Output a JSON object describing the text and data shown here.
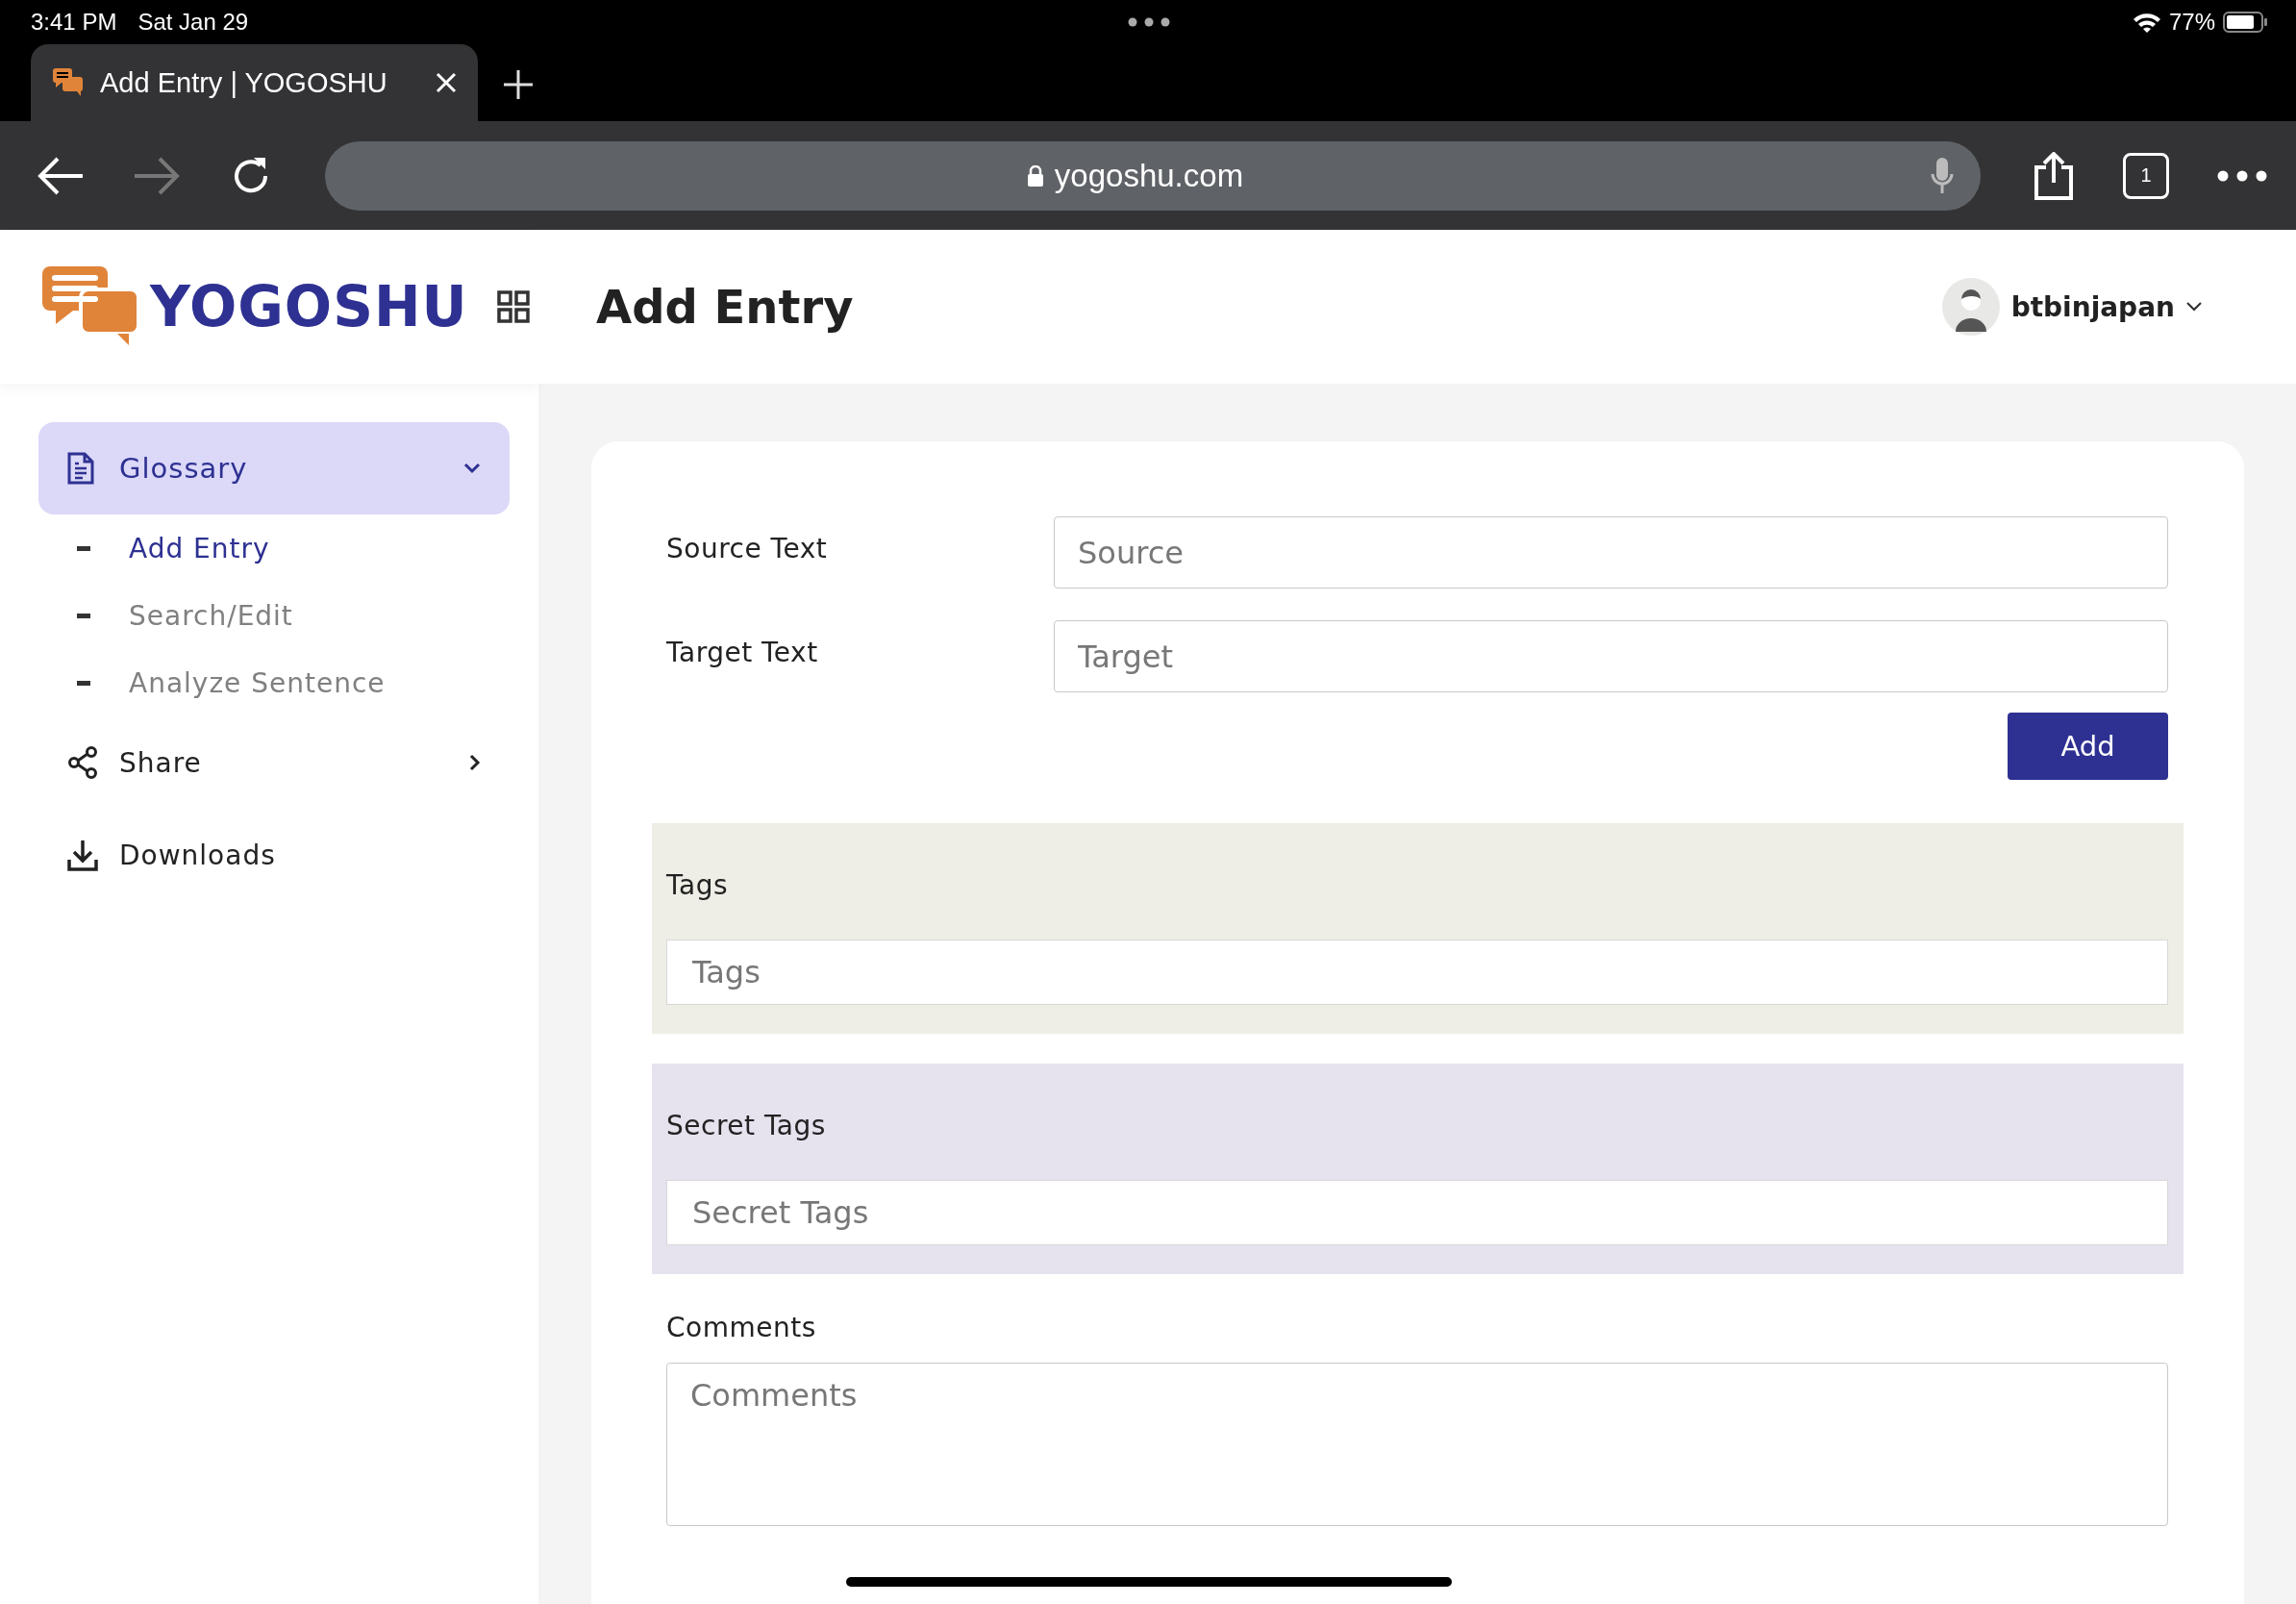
{
  "status_bar": {
    "time": "3:41 PM",
    "date": "Sat Jan 29",
    "battery": "77%"
  },
  "browser": {
    "tab": {
      "title": "Add Entry | YOGOSHU"
    },
    "url": "yogoshu.com",
    "tab_count": "1"
  },
  "sidebar": {
    "logo": "YOGOSHU",
    "items": [
      {
        "kind": "group",
        "label": "Glossary",
        "expanded": true,
        "children": [
          {
            "label": "Add Entry",
            "selected": true
          },
          {
            "label": "Search/Edit",
            "selected": false
          },
          {
            "label": "Analyze Sentence",
            "selected": false
          }
        ]
      },
      {
        "kind": "share",
        "label": "Share",
        "expanded": false
      },
      {
        "kind": "download",
        "label": "Downloads"
      }
    ]
  },
  "header": {
    "title": "Add Entry",
    "user": "btbinjapan"
  },
  "form": {
    "fields": [
      {
        "label": "Source Text",
        "placeholder": "Source"
      },
      {
        "label": "Target Text",
        "placeholder": "Target"
      }
    ],
    "add_button": "Add",
    "panels": [
      {
        "kind": "tags",
        "label": "Tags",
        "placeholder": "Tags"
      },
      {
        "kind": "secret",
        "label": "Secret Tags",
        "placeholder": "Secret Tags"
      }
    ],
    "comments": {
      "label": "Comments",
      "placeholder": "Comments"
    }
  }
}
